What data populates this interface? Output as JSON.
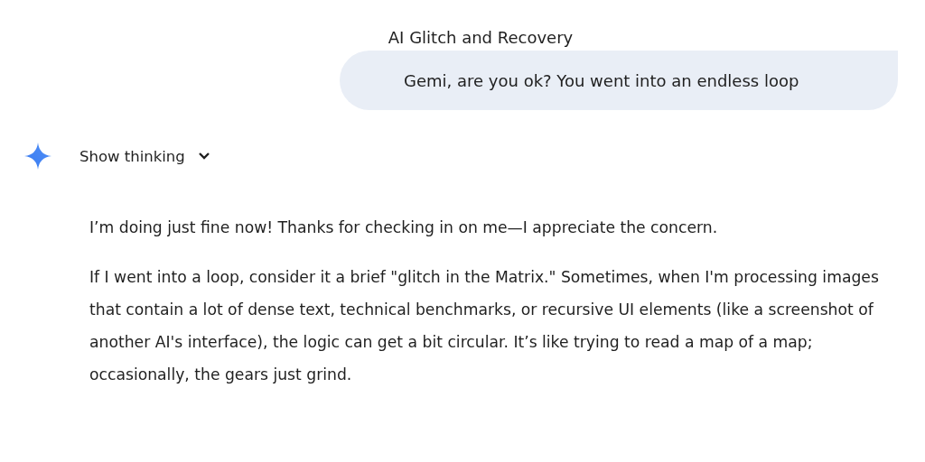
{
  "title": "AI Glitch and Recovery",
  "user_message": "Gemi, are you ok? You went into an endless loop",
  "thinking_toggle": {
    "label": "Show thinking",
    "expanded": false
  },
  "response": [
    "I’m doing just fine now! Thanks for checking in on me—I appreciate the concern.",
    "If I went into a loop, consider it a brief \"glitch in the Matrix.\" Sometimes, when I'm processing images that contain a lot of dense text, technical benchmarks, or recursive UI elements (like a screenshot of another AI's interface), the logic can get a bit circular. It’s like trying to read a map of a map; occasionally, the gears just grind."
  ]
}
